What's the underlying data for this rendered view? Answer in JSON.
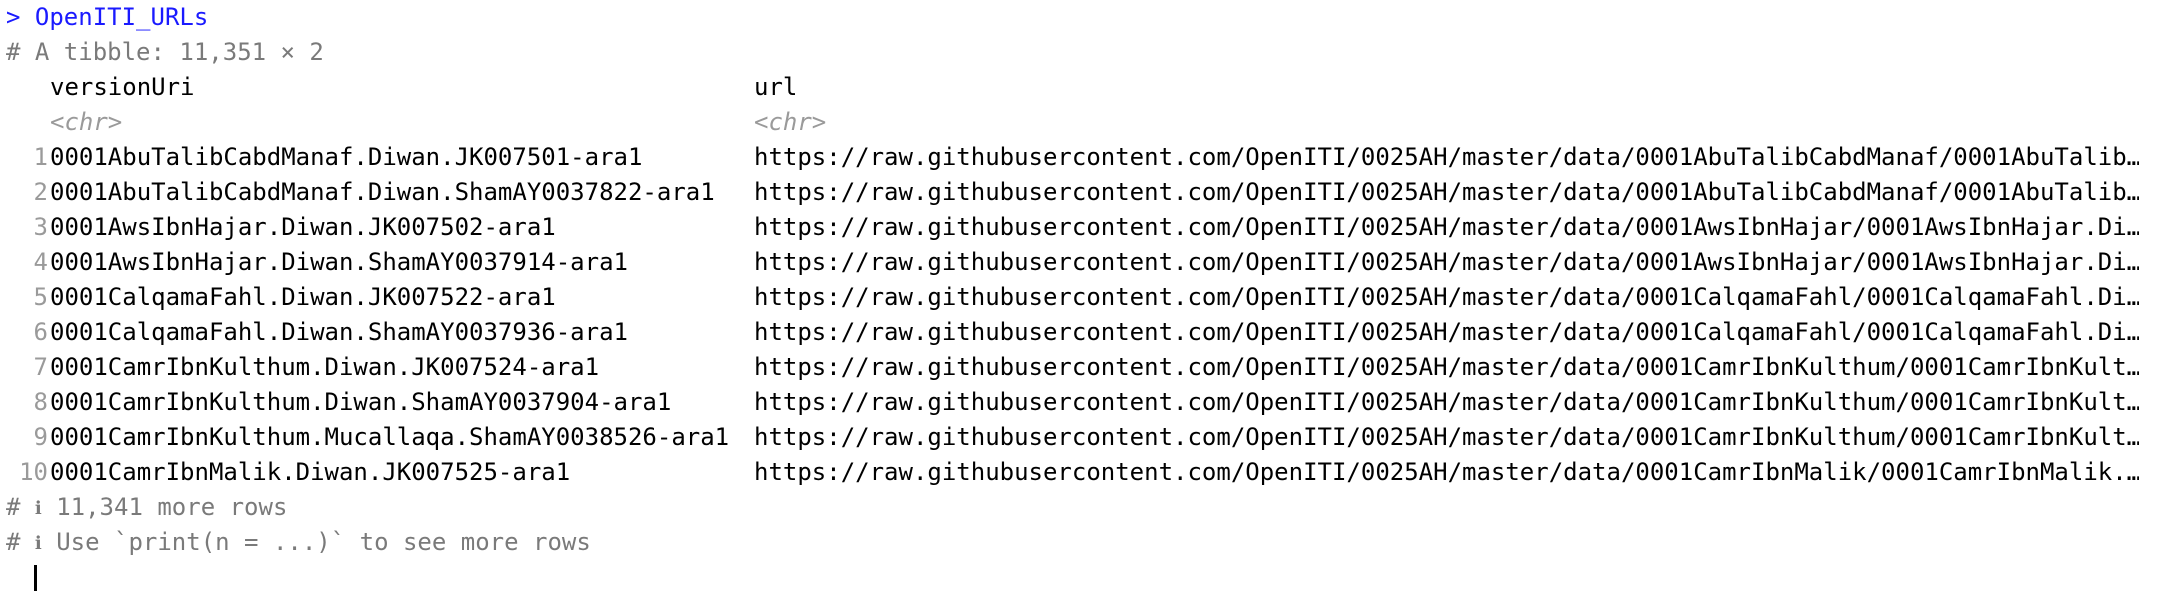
{
  "console": {
    "prompt_symbol": ">",
    "command": "OpenITI_URLs",
    "tibble_header": "# A tibble: 11,351 × 2"
  },
  "columns": {
    "c1": {
      "name": "versionUri",
      "type": "<chr>"
    },
    "c2": {
      "name": "url",
      "type": "<chr>"
    }
  },
  "rows": [
    {
      "n": "1",
      "versionUri": "0001AbuTalibCabdManaf.Diwan.JK007501-ara1",
      "url": "https://raw.githubusercontent.com/OpenITI/0025AH/master/data/0001AbuTalibCabdManaf/0001AbuTalib…"
    },
    {
      "n": "2",
      "versionUri": "0001AbuTalibCabdManaf.Diwan.ShamAY0037822-ara1",
      "url": "https://raw.githubusercontent.com/OpenITI/0025AH/master/data/0001AbuTalibCabdManaf/0001AbuTalib…"
    },
    {
      "n": "3",
      "versionUri": "0001AwsIbnHajar.Diwan.JK007502-ara1",
      "url": "https://raw.githubusercontent.com/OpenITI/0025AH/master/data/0001AwsIbnHajar/0001AwsIbnHajar.Di…"
    },
    {
      "n": "4",
      "versionUri": "0001AwsIbnHajar.Diwan.ShamAY0037914-ara1",
      "url": "https://raw.githubusercontent.com/OpenITI/0025AH/master/data/0001AwsIbnHajar/0001AwsIbnHajar.Di…"
    },
    {
      "n": "5",
      "versionUri": "0001CalqamaFahl.Diwan.JK007522-ara1",
      "url": "https://raw.githubusercontent.com/OpenITI/0025AH/master/data/0001CalqamaFahl/0001CalqamaFahl.Di…"
    },
    {
      "n": "6",
      "versionUri": "0001CalqamaFahl.Diwan.ShamAY0037936-ara1",
      "url": "https://raw.githubusercontent.com/OpenITI/0025AH/master/data/0001CalqamaFahl/0001CalqamaFahl.Di…"
    },
    {
      "n": "7",
      "versionUri": "0001CamrIbnKulthum.Diwan.JK007524-ara1",
      "url": "https://raw.githubusercontent.com/OpenITI/0025AH/master/data/0001CamrIbnKulthum/0001CamrIbnKult…"
    },
    {
      "n": "8",
      "versionUri": "0001CamrIbnKulthum.Diwan.ShamAY0037904-ara1",
      "url": "https://raw.githubusercontent.com/OpenITI/0025AH/master/data/0001CamrIbnKulthum/0001CamrIbnKult…"
    },
    {
      "n": "9",
      "versionUri": "0001CamrIbnKulthum.Mucallaqa.ShamAY0038526-ara1",
      "url": "https://raw.githubusercontent.com/OpenITI/0025AH/master/data/0001CamrIbnKulthum/0001CamrIbnKult…"
    },
    {
      "n": "10",
      "versionUri": "0001CamrIbnMalik.Diwan.JK007525-ara1",
      "url": "https://raw.githubusercontent.com/OpenITI/0025AH/master/data/0001CamrIbnMalik/0001CamrIbnMalik.…"
    }
  ],
  "footer": {
    "comment_prefix": "#",
    "info_icon": "ℹ",
    "more_rows": "11,341 more rows",
    "hint": "Use `print(n = ...)` to see more rows"
  },
  "colors": {
    "prompt": "#1a1aff",
    "comment": "#7a7a7a",
    "type": "#9a9a9a"
  }
}
